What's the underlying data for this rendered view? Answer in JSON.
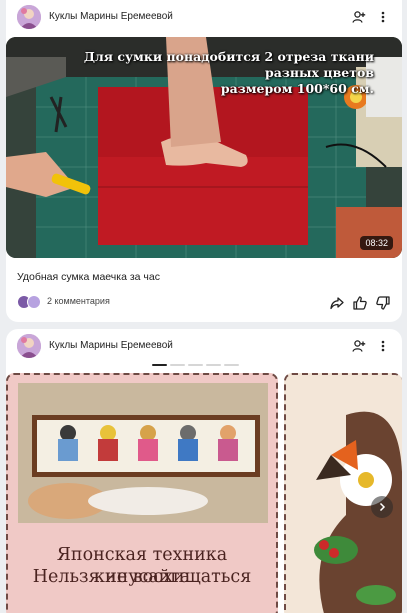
{
  "posts": [
    {
      "channel_name": "Куклы Марины Еремеевой",
      "overlay_text": [
        "Для сумки понадобится 2 отреза ткани",
        "разных цветов",
        "размером 100*60 см."
      ],
      "duration": "08:32",
      "title": "Удобная сумка маечка за час",
      "comments": "2 комментария"
    },
    {
      "channel_name": "Куклы Марины Еремеевой",
      "slide_caption": [
        "Японская техника кинусайга",
        "Нельзя не восхищаться"
      ],
      "carousel_pages": 5,
      "carousel_active": 0
    }
  ],
  "icons": {
    "subscribe": "add-person-icon",
    "menu": "vertical-dots-icon",
    "share": "share-arrow-icon",
    "like": "thumbs-up-icon",
    "dislike": "thumbs-down-icon",
    "next": "chevron-right-icon"
  },
  "colors": {
    "page_bg": "#eceef1",
    "card_bg": "#ffffff",
    "slide_bg": "#f0c9c6",
    "caption": "#4a2320"
  }
}
